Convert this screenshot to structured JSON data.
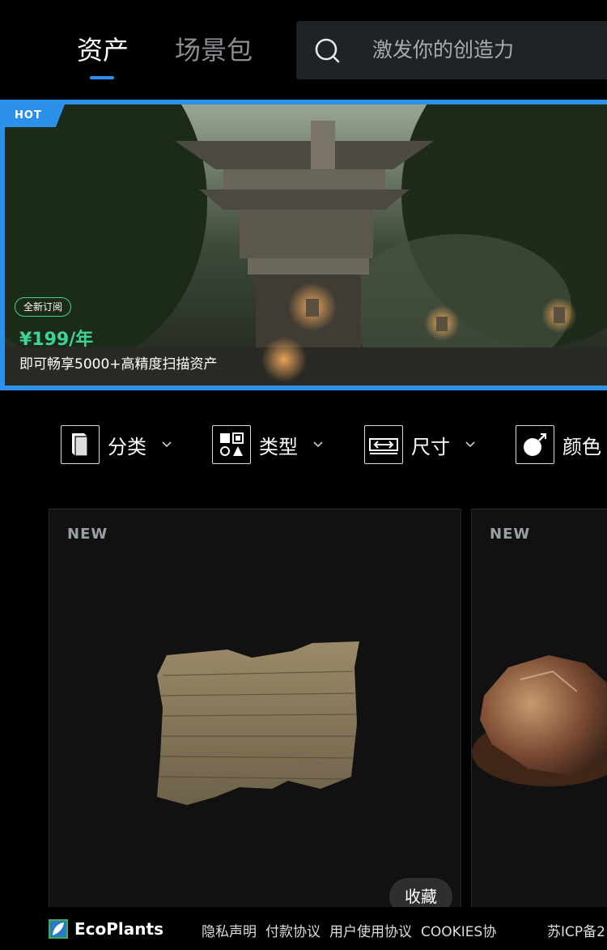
{
  "header": {
    "tabs": [
      {
        "label": "资产",
        "active": true
      },
      {
        "label": "场景包",
        "active": false
      }
    ],
    "search": {
      "placeholder": "激发你的创造力"
    }
  },
  "banner": {
    "badge": "HOT",
    "subscription_tag": "全新订阅",
    "price": "¥199/年",
    "description": "即可畅享5000+高精度扫描资产"
  },
  "filters": [
    {
      "label": "分类",
      "icon": "book-icon"
    },
    {
      "label": "类型",
      "icon": "type-grid-icon"
    },
    {
      "label": "尺寸",
      "icon": "size-ruler-icon"
    },
    {
      "label": "颜色",
      "icon": "color-icon"
    }
  ],
  "cards": [
    {
      "tag": "NEW",
      "fav_label": "收藏"
    },
    {
      "tag": "NEW"
    }
  ],
  "footer": {
    "brand": "EcoPlants",
    "links": [
      "隐私声明",
      "付款协议",
      "用户使用协议",
      "COOKIES协"
    ],
    "icp": "苏ICP备2"
  },
  "colors": {
    "accent": "#2b90e8",
    "price_green": "#3fd29a",
    "background": "#000000",
    "card_bg": "#111111"
  }
}
